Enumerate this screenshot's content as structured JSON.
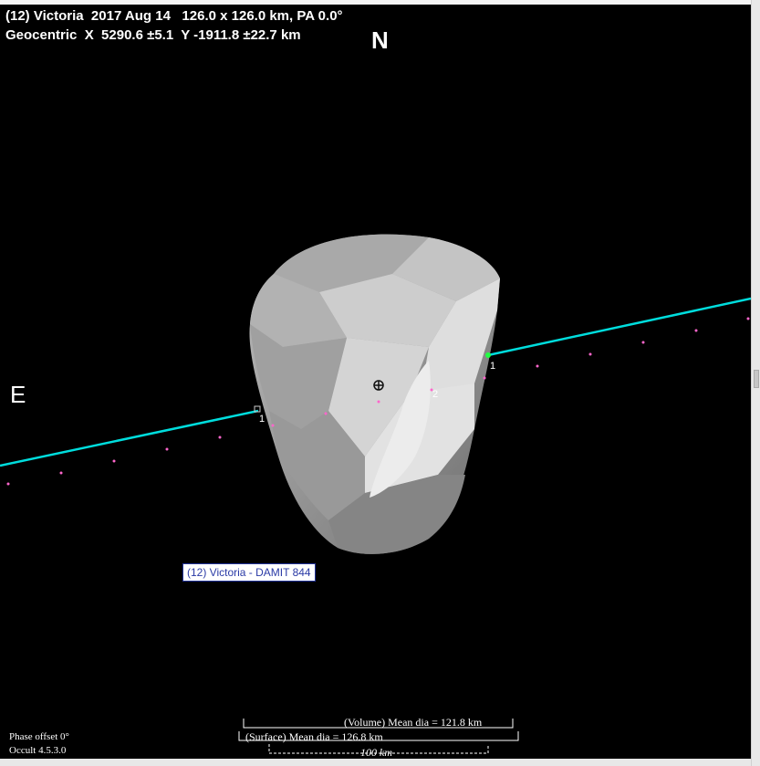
{
  "header": {
    "title_line": "(12) Victoria  2017 Aug 14   126.0 x 126.0 km, PA 0.0°",
    "geocentric_line": "Geocentric  X  5290.6 ±5.1  Y -1911.8 ±22.7 km"
  },
  "compass": {
    "north": "N",
    "east": "E"
  },
  "chords": [
    {
      "label": "1",
      "color": "#00dddd"
    },
    {
      "label": "1",
      "color": "#00dddd"
    },
    {
      "label": "2",
      "color": "#ff66cc"
    }
  ],
  "shape_model": {
    "label": "(12) Victoria - DAMIT 844"
  },
  "info": {
    "phase_offset": "Phase offset 0°",
    "version": "Occult 4.5.3.0"
  },
  "diameters": {
    "volume": "(Volume) Mean dia = 121.8 km",
    "surface": "(Surface) Mean dia = 126.8 km",
    "scale": "100 km"
  },
  "colors": {
    "background": "#000000",
    "chord": "#00dddd",
    "dot": "#ff66cc",
    "label_text": "#2a3aa6"
  }
}
